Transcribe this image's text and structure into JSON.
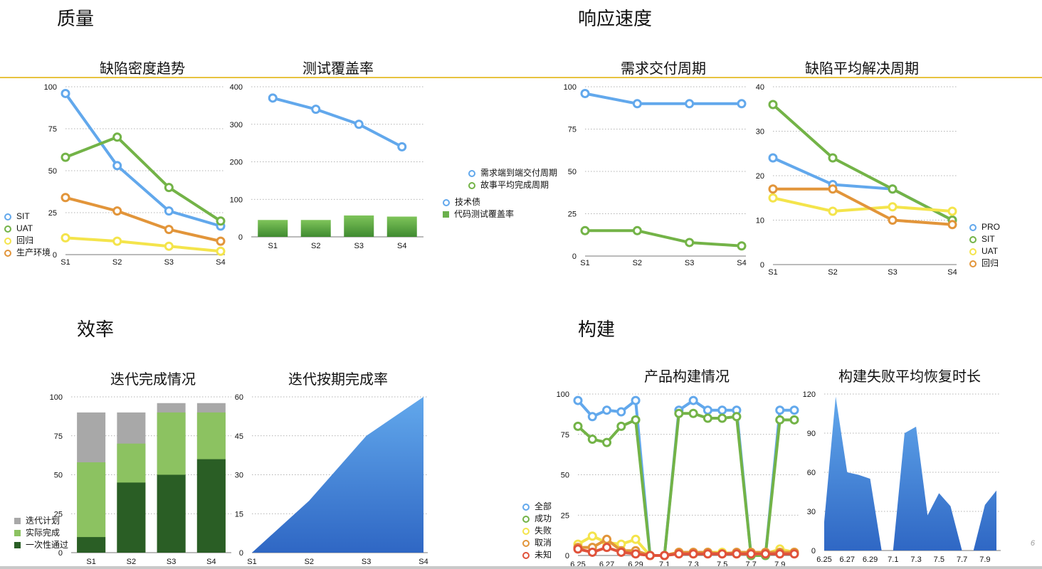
{
  "sections": {
    "quality": "质量",
    "response": "响应速度",
    "efficiency": "效率",
    "build": "构建"
  },
  "page_number": "6",
  "colors": {
    "blue": "#62a8ec",
    "green": "#73b347",
    "yellow": "#f4e44b",
    "orange": "#e2953a",
    "red": "#e0523a",
    "gray": "#a8a8a8",
    "light_green": "#8cc261",
    "dark_green": "#2a5e25",
    "accent_line": "#e8c340"
  },
  "chart_data": [
    {
      "id": "defect_trend",
      "type": "line",
      "title": "缺陷密度趋势",
      "categories": [
        "S1",
        "S2",
        "S3",
        "S4"
      ],
      "ylim": [
        0,
        100
      ],
      "yticks": [
        0,
        25,
        50,
        75,
        100
      ],
      "series": [
        {
          "name": "SIT",
          "color": "#62a8ec",
          "values": [
            96,
            53,
            26,
            17
          ]
        },
        {
          "name": "UAT",
          "color": "#73b347",
          "values": [
            58,
            70,
            40,
            20
          ]
        },
        {
          "name": "回归",
          "color": "#f4e44b",
          "values": [
            10,
            8,
            5,
            2
          ]
        },
        {
          "name": "生产环境",
          "color": "#e2953a",
          "values": [
            34,
            26,
            15,
            8
          ]
        }
      ],
      "legend": "left"
    },
    {
      "id": "coverage",
      "type": "bar",
      "title": "测试覆盖率",
      "categories": [
        "S1",
        "S2",
        "S3",
        "S4"
      ],
      "ylim": [
        0,
        400
      ],
      "yticks": [
        0,
        100,
        200,
        300,
        400
      ],
      "series": [
        {
          "name": "技术债",
          "kind": "line",
          "color": "#62a8ec",
          "values": [
            370,
            340,
            300,
            240
          ]
        },
        {
          "name": "代码测试覆盖率",
          "kind": "bar",
          "color": "#6ab04c",
          "values": [
            45,
            45,
            57,
            54
          ]
        }
      ],
      "legend": "right"
    },
    {
      "id": "delivery_cycle",
      "type": "line",
      "title": "需求交付周期",
      "categories": [
        "S1",
        "S2",
        "S3",
        "S4"
      ],
      "ylim": [
        0,
        100
      ],
      "yticks": [
        0,
        25,
        50,
        75,
        100
      ],
      "series": [
        {
          "name": "需求端到端交付周期",
          "color": "#62a8ec",
          "values": [
            96,
            90,
            90,
            90
          ]
        },
        {
          "name": "故事平均完成周期",
          "color": "#73b347",
          "values": [
            15,
            15,
            8,
            6
          ]
        }
      ],
      "legend": "left"
    },
    {
      "id": "defect_resolution",
      "type": "line",
      "title": "缺陷平均解决周期",
      "categories": [
        "S1",
        "S2",
        "S3",
        "S4"
      ],
      "ylim": [
        0,
        40
      ],
      "yticks": [
        0,
        10,
        20,
        30,
        40
      ],
      "series": [
        {
          "name": "PRO",
          "color": "#62a8ec",
          "values": [
            24,
            18,
            17,
            10
          ]
        },
        {
          "name": "SIT",
          "color": "#73b347",
          "values": [
            36,
            24,
            17,
            10
          ]
        },
        {
          "name": "UAT",
          "color": "#f4e44b",
          "values": [
            15,
            12,
            13,
            12
          ]
        },
        {
          "name": "回归",
          "color": "#e2953a",
          "values": [
            17,
            17,
            10,
            9
          ]
        }
      ],
      "legend": "right"
    },
    {
      "id": "iteration_completion",
      "type": "bar",
      "stacked": true,
      "title": "迭代完成情况",
      "categories": [
        "S1",
        "S2",
        "S3",
        "S4"
      ],
      "ylim": [
        0,
        100
      ],
      "yticks": [
        0,
        25,
        50,
        75,
        100
      ],
      "series": [
        {
          "name": "迭代计划",
          "color": "#a8a8a8",
          "values": [
            90,
            90,
            96,
            96
          ]
        },
        {
          "name": "实际完成",
          "color": "#8cc261",
          "values": [
            58,
            70,
            90,
            90
          ]
        },
        {
          "name": "一次性通过",
          "color": "#2a5e25",
          "values": [
            10,
            45,
            50,
            60
          ]
        }
      ],
      "legend": "left"
    },
    {
      "id": "ontime_rate",
      "type": "area",
      "title": "迭代按期完成率",
      "categories": [
        "S1",
        "S2",
        "S3",
        "S4"
      ],
      "ylim": [
        0,
        60
      ],
      "yticks": [
        0,
        15,
        30,
        45,
        60
      ],
      "series": [
        {
          "color": "#3f7fd6",
          "values": [
            0,
            20,
            45,
            60
          ]
        }
      ]
    },
    {
      "id": "product_builds",
      "type": "line",
      "title": "产品构建情况",
      "x": [
        "6.25",
        "6.26",
        "6.27",
        "6.28",
        "6.29",
        "6.30",
        "7.1",
        "7.2",
        "7.3",
        "7.4",
        "7.5",
        "7.6",
        "7.7",
        "7.8",
        "7.9",
        "7.10"
      ],
      "xticks": [
        "6.25",
        "6.27",
        "6.29",
        "7.1",
        "7.3",
        "7.5",
        "7.7",
        "7.9"
      ],
      "ylim": [
        0,
        100
      ],
      "yticks": [
        0,
        25,
        50,
        75,
        100
      ],
      "series": [
        {
          "name": "全部",
          "color": "#62a8ec",
          "values": [
            96,
            86,
            90,
            89,
            96,
            0,
            0,
            90,
            96,
            90,
            90,
            90,
            0,
            0,
            90,
            90
          ]
        },
        {
          "name": "成功",
          "color": "#73b347",
          "values": [
            80,
            72,
            70,
            80,
            84,
            0,
            0,
            88,
            88,
            85,
            85,
            86,
            0,
            0,
            84,
            84
          ]
        },
        {
          "name": "失败",
          "color": "#f4e44b",
          "values": [
            7,
            12,
            8,
            7,
            10,
            0,
            0,
            2,
            1,
            2,
            2,
            1,
            1,
            1,
            4,
            2
          ]
        },
        {
          "name": "取消",
          "color": "#e2953a",
          "values": [
            5,
            5,
            10,
            3,
            3,
            0,
            0,
            2,
            2,
            2,
            1,
            2,
            2,
            2,
            2,
            2
          ]
        },
        {
          "name": "未知",
          "color": "#e0523a",
          "values": [
            4,
            2,
            5,
            2,
            1,
            0,
            0,
            1,
            1,
            1,
            1,
            1,
            1,
            1,
            1,
            1
          ]
        }
      ],
      "legend": "left"
    },
    {
      "id": "build_recovery",
      "type": "area",
      "title": "构建失败平均恢复时长",
      "x": [
        "6.25",
        "6.26",
        "6.27",
        "6.28",
        "6.29",
        "6.30",
        "7.1",
        "7.2",
        "7.3",
        "7.4",
        "7.5",
        "7.6",
        "7.7",
        "7.8",
        "7.9",
        "7.10"
      ],
      "xticks": [
        "6.25",
        "6.27",
        "6.29",
        "7.1",
        "7.3",
        "7.5",
        "7.7",
        "7.9"
      ],
      "ylim": [
        0,
        120
      ],
      "yticks": [
        0,
        30,
        60,
        90,
        120
      ],
      "series": [
        {
          "color": "#3f7fd6",
          "values": [
            22,
            118,
            60,
            58,
            55,
            0,
            0,
            90,
            95,
            27,
            44,
            34,
            0,
            0,
            35,
            46
          ]
        }
      ]
    }
  ]
}
